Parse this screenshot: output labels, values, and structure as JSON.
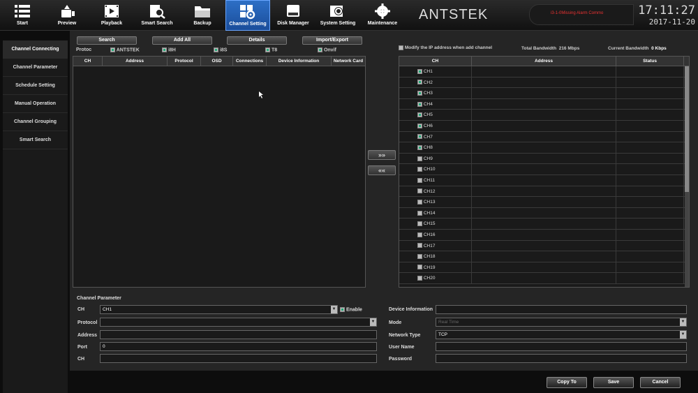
{
  "nav": [
    {
      "label": "Start",
      "icon": "start-icon"
    },
    {
      "label": "Preview",
      "icon": "preview-icon"
    },
    {
      "label": "Playback",
      "icon": "playback-icon"
    },
    {
      "label": "Smart Search",
      "icon": "smart-search-icon"
    },
    {
      "label": "Backup",
      "icon": "backup-icon"
    },
    {
      "label": "Channel Setting",
      "icon": "channel-setting-icon"
    },
    {
      "label": "Disk Manager",
      "icon": "disk-manager-icon"
    },
    {
      "label": "System Setting",
      "icon": "system-setting-icon"
    },
    {
      "label": "Maintenance",
      "icon": "maintenance-icon"
    }
  ],
  "brand": "ANTSTEK",
  "alarm_text": "i3-1-0Missing Alarm   Commo",
  "time": "17:11:27",
  "date": "2017-11-20",
  "sidebar": [
    {
      "label": "Channel Connecting"
    },
    {
      "label": "Channel Parameter"
    },
    {
      "label": "Schedule Setting"
    },
    {
      "label": "Manual Operation"
    },
    {
      "label": "Channel Grouping"
    },
    {
      "label": "Smart Search"
    }
  ],
  "toolbar": {
    "search": "Search",
    "add_all": "Add All",
    "details": "Details",
    "import_export": "Import/Export"
  },
  "protocols": {
    "label": "Protoc",
    "items": [
      "ANTSTEK",
      "i8H",
      "i8S",
      "T8",
      "Onvif"
    ]
  },
  "device_table": {
    "headers": [
      "CH",
      "Address",
      "Protocol",
      "OSD",
      "Connections",
      "Device Information",
      "Network Card"
    ]
  },
  "arrows": {
    "add": "»»",
    "remove": "««"
  },
  "right_panel": {
    "modify_label": "Modify the IP address when add channel",
    "total_bw_label": "Total Bandwidth",
    "total_bw": "216 Mbps",
    "current_bw_label": "Current Bandwidth",
    "current_bw": "0 Kbps",
    "headers": [
      "CH",
      "Address",
      "Status"
    ],
    "channels": [
      "CH1",
      "CH2",
      "CH3",
      "CH4",
      "CH5",
      "CH6",
      "CH7",
      "CH8",
      "CH9",
      "CH10",
      "CH11",
      "CH12",
      "CH13",
      "CH14",
      "CH15",
      "CH16",
      "CH17",
      "CH18",
      "CH19",
      "CH20"
    ]
  },
  "params": {
    "title": "Channel Parameter",
    "ch_label": "CH",
    "ch_value": "CH1",
    "enable_label": "Enable",
    "protocol_label": "Protocol",
    "protocol_value": "",
    "address_label": "Address",
    "address_value": "",
    "port_label": "Port",
    "port_value": "0",
    "ch2_label": "CH",
    "ch2_value": "",
    "devinfo_label": "Device Information",
    "devinfo_value": "",
    "mode_label": "Mode",
    "mode_value": "Real Time",
    "nettype_label": "Network Type",
    "nettype_value": "TCP",
    "user_label": "User Name",
    "user_value": "",
    "pass_label": "Password",
    "pass_value": ""
  },
  "footer": {
    "copy": "Copy To",
    "save": "Save",
    "cancel": "Cancel"
  }
}
